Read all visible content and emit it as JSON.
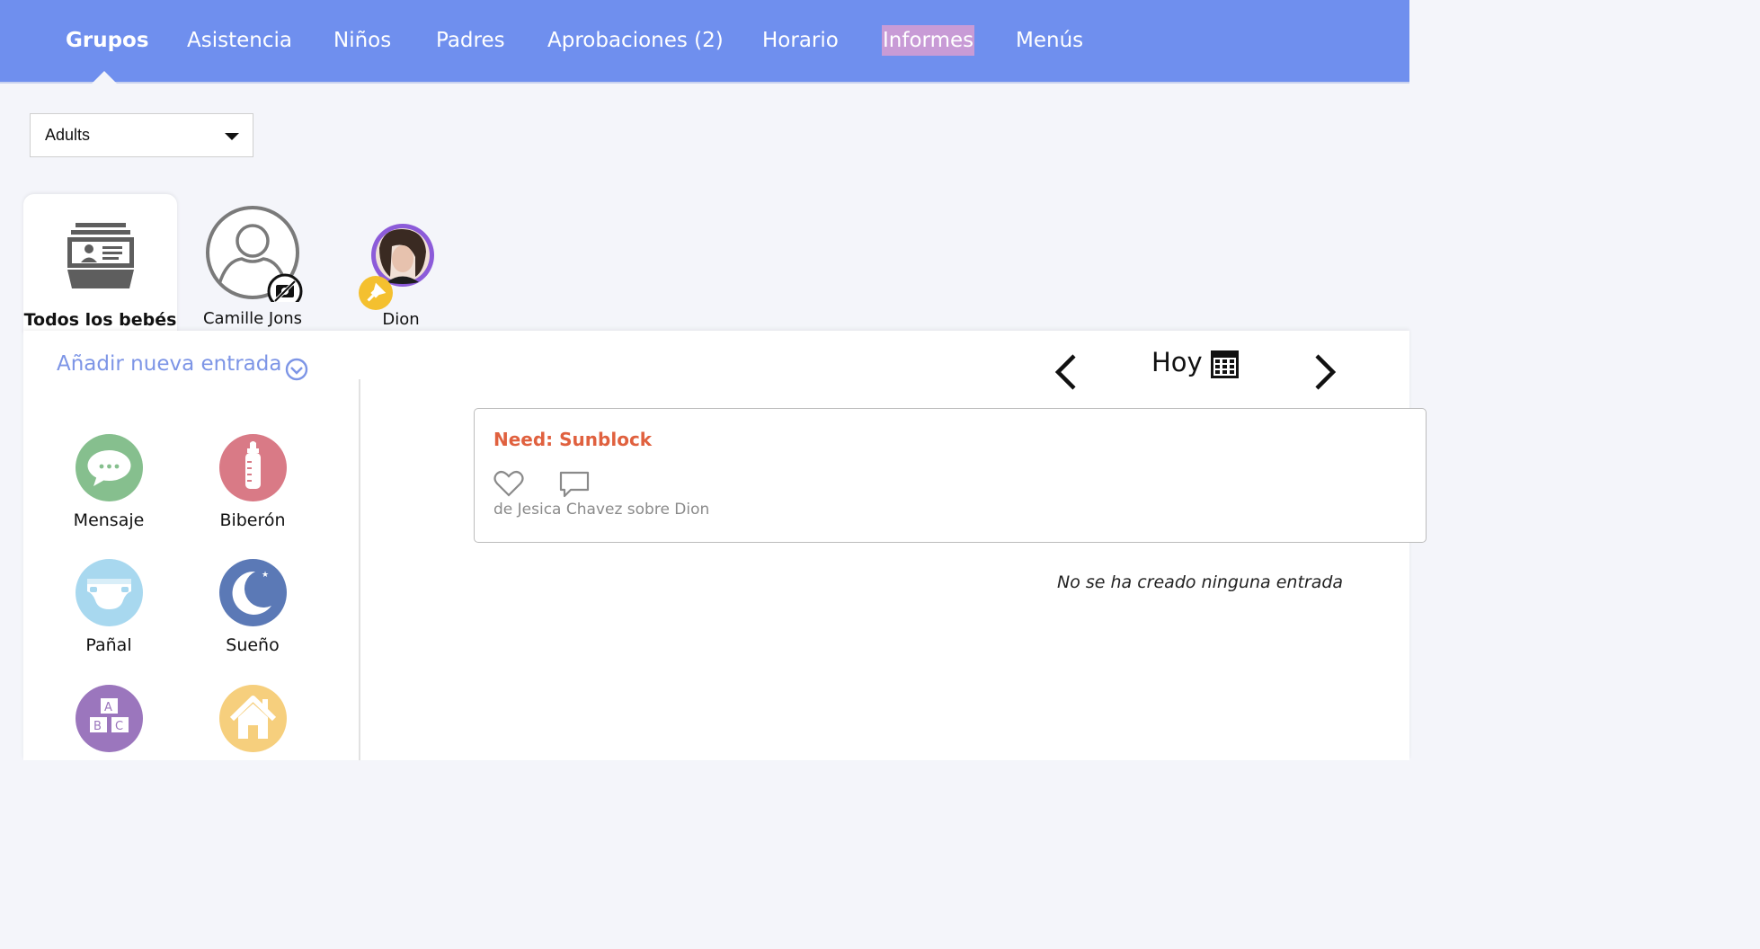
{
  "nav": {
    "items": [
      {
        "label": "Grupos",
        "active": true
      },
      {
        "label": "Asistencia"
      },
      {
        "label": "Niños"
      },
      {
        "label": "Padres"
      },
      {
        "label": "Aprobaciones (2)"
      },
      {
        "label": "Horario"
      },
      {
        "label": "Informes",
        "highlighted": true
      },
      {
        "label": "Menús"
      }
    ]
  },
  "group_select": {
    "value": "Adults"
  },
  "tabs": {
    "all_label": "Todos los bebés",
    "kids": [
      {
        "name": "Camille Jons",
        "avatar": "default-person-icon",
        "badge": "no-photo-icon"
      },
      {
        "name": "Dion",
        "avatar": "photo",
        "badge": "pin-icon"
      }
    ]
  },
  "add_entry": {
    "label": "Añadir nueva entrada"
  },
  "activities": [
    {
      "label": "Mensaje",
      "icon": "message-icon",
      "color": "#86bf8e"
    },
    {
      "label": "Biberón",
      "icon": "bottle-icon",
      "color": "#d97a86"
    },
    {
      "label": "Pañal",
      "icon": "diaper-icon",
      "color": "#a8d8ef"
    },
    {
      "label": "Sueño",
      "icon": "moon-icon",
      "color": "#5b79b6"
    },
    {
      "label": "",
      "icon": "blocks-icon",
      "color": "#9b76bd"
    },
    {
      "label": "",
      "icon": "home-icon",
      "color": "#f6cf7d"
    }
  ],
  "date_nav": {
    "label": "Hoy"
  },
  "entry": {
    "title": "Need: Sunblock",
    "meta": "de Jesica Chavez sobre Dion",
    "title_color": "#e0613f"
  },
  "empty_message": "No se ha creado ninguna entrada",
  "colors": {
    "nav_bg": "#6f8fee",
    "accent": "#7d95e6",
    "page_bg": "#f4f5fa"
  }
}
